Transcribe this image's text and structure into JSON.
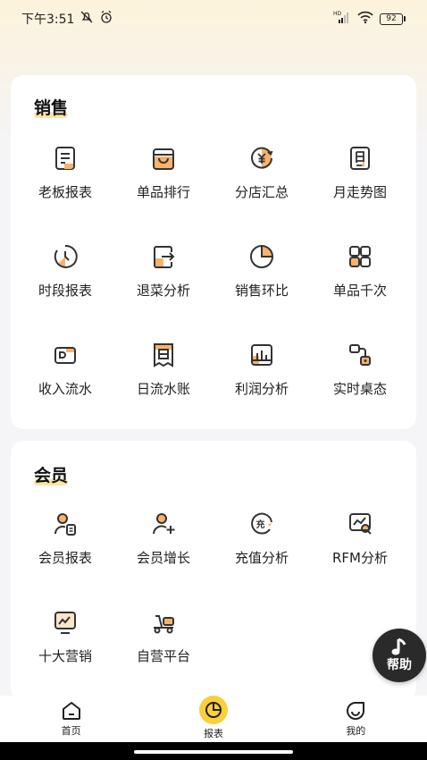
{
  "status_bar": {
    "time": "下午3:51",
    "battery": "92",
    "network_label": "HD"
  },
  "sales": {
    "title": "销售",
    "items": [
      {
        "label": "老板报表",
        "icon": "boss-report-icon"
      },
      {
        "label": "单品排行",
        "icon": "item-rank-icon"
      },
      {
        "label": "分店汇总",
        "icon": "branch-summary-icon"
      },
      {
        "label": "月走势图",
        "icon": "monthly-trend-icon"
      },
      {
        "label": "时段报表",
        "icon": "time-period-icon"
      },
      {
        "label": "退菜分析",
        "icon": "return-dish-icon"
      },
      {
        "label": "销售环比",
        "icon": "sales-ratio-icon"
      },
      {
        "label": "单品千次",
        "icon": "item-per-thousand-icon"
      },
      {
        "label": "收入流水",
        "icon": "income-flow-icon"
      },
      {
        "label": "日流水账",
        "icon": "daily-ledger-icon"
      },
      {
        "label": "利润分析",
        "icon": "profit-analysis-icon"
      },
      {
        "label": "实时桌态",
        "icon": "table-status-icon"
      }
    ]
  },
  "member": {
    "title": "会员",
    "items": [
      {
        "label": "会员报表",
        "icon": "member-report-icon"
      },
      {
        "label": "会员增长",
        "icon": "member-growth-icon"
      },
      {
        "label": "充值分析",
        "icon": "recharge-analysis-icon"
      },
      {
        "label": "RFM分析",
        "icon": "rfm-analysis-icon"
      },
      {
        "label": "十大营销",
        "icon": "top-marketing-icon"
      },
      {
        "label": "自营平台",
        "icon": "self-platform-icon"
      }
    ]
  },
  "help": {
    "label": "帮助"
  },
  "tabbar": {
    "items": [
      {
        "label": "首页"
      },
      {
        "label": "报表"
      },
      {
        "label": "我的"
      }
    ]
  },
  "colors": {
    "accent": "#fbcf3c",
    "icon_orange": "#f7b36b",
    "icon_stroke": "#333333"
  }
}
